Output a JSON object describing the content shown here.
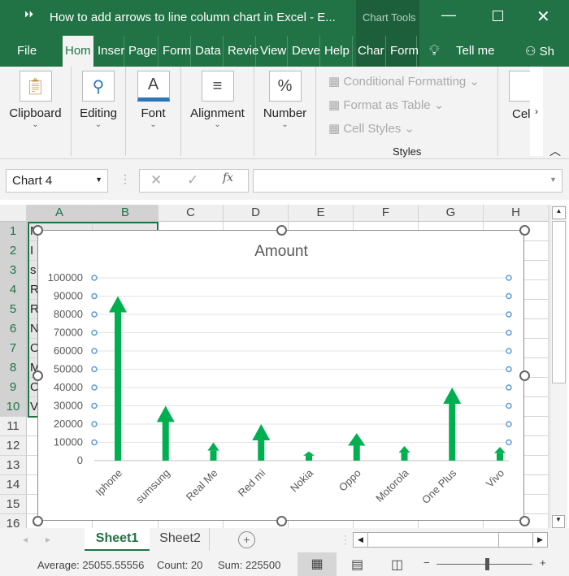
{
  "window": {
    "title": "How to add arrows to line  column chart in Excel  -  E...",
    "context_tab": "Chart Tools"
  },
  "menu": {
    "tabs": [
      "File",
      "Hom",
      "Inser",
      "Page",
      "Form",
      "Data",
      "Revie",
      "View",
      "Deve",
      "Help",
      "Char",
      "Form"
    ],
    "tell_me": "Tell me",
    "share": "Sh"
  },
  "ribbon": {
    "groups": [
      {
        "label": "Clipboard",
        "icon": "clipboard-icon"
      },
      {
        "label": "Editing",
        "icon": "search-icon"
      },
      {
        "label": "Font",
        "icon": "font-color-icon",
        "glyph": "A"
      },
      {
        "label": "Alignment",
        "icon": "align-icon",
        "glyph": "≡"
      },
      {
        "label": "Number",
        "icon": "percent-icon",
        "glyph": "%"
      }
    ],
    "styles": {
      "items": [
        "Conditional Formatting",
        "Format as Table",
        "Cell Styles"
      ],
      "label": "Styles"
    },
    "cells_label": "Cel"
  },
  "formula_bar": {
    "name_box": "Chart 4",
    "fx": "fx",
    "value": ""
  },
  "grid": {
    "columns": [
      "A",
      "B",
      "C",
      "D",
      "E",
      "F",
      "G",
      "H"
    ],
    "rows": [
      "1",
      "2",
      "3",
      "4",
      "5",
      "6",
      "7",
      "8",
      "9",
      "10",
      "11",
      "12",
      "13",
      "14",
      "15",
      "16"
    ],
    "col_a_visible": [
      "N",
      "I",
      "s",
      "R",
      "R",
      "N",
      "O",
      "M",
      "O",
      "V"
    ]
  },
  "chart_data": {
    "type": "bar",
    "title": "Amount",
    "categories": [
      "Iphone",
      "sumsung",
      "Real Me",
      "Red mi",
      "Nokia",
      "Oppo",
      "Motorola",
      "One Plus",
      "Vivo"
    ],
    "values": [
      90000,
      30000,
      10000,
      20000,
      5000,
      15000,
      8000,
      40000,
      7500
    ],
    "bar_style": "arrow",
    "bar_color": "#00b050",
    "ylim": [
      0,
      100000
    ],
    "yticks": [
      "0",
      "10000",
      "20000",
      "30000",
      "40000",
      "50000",
      "60000",
      "70000",
      "80000",
      "90000",
      "100000"
    ],
    "grid": true,
    "legend": "none"
  },
  "sheets": {
    "tabs": [
      "Sheet1",
      "Sheet2"
    ],
    "active": "Sheet1"
  },
  "status": {
    "average": "Average: 25055.55556",
    "count": "Count: 20",
    "sum": "Sum: 225500"
  }
}
